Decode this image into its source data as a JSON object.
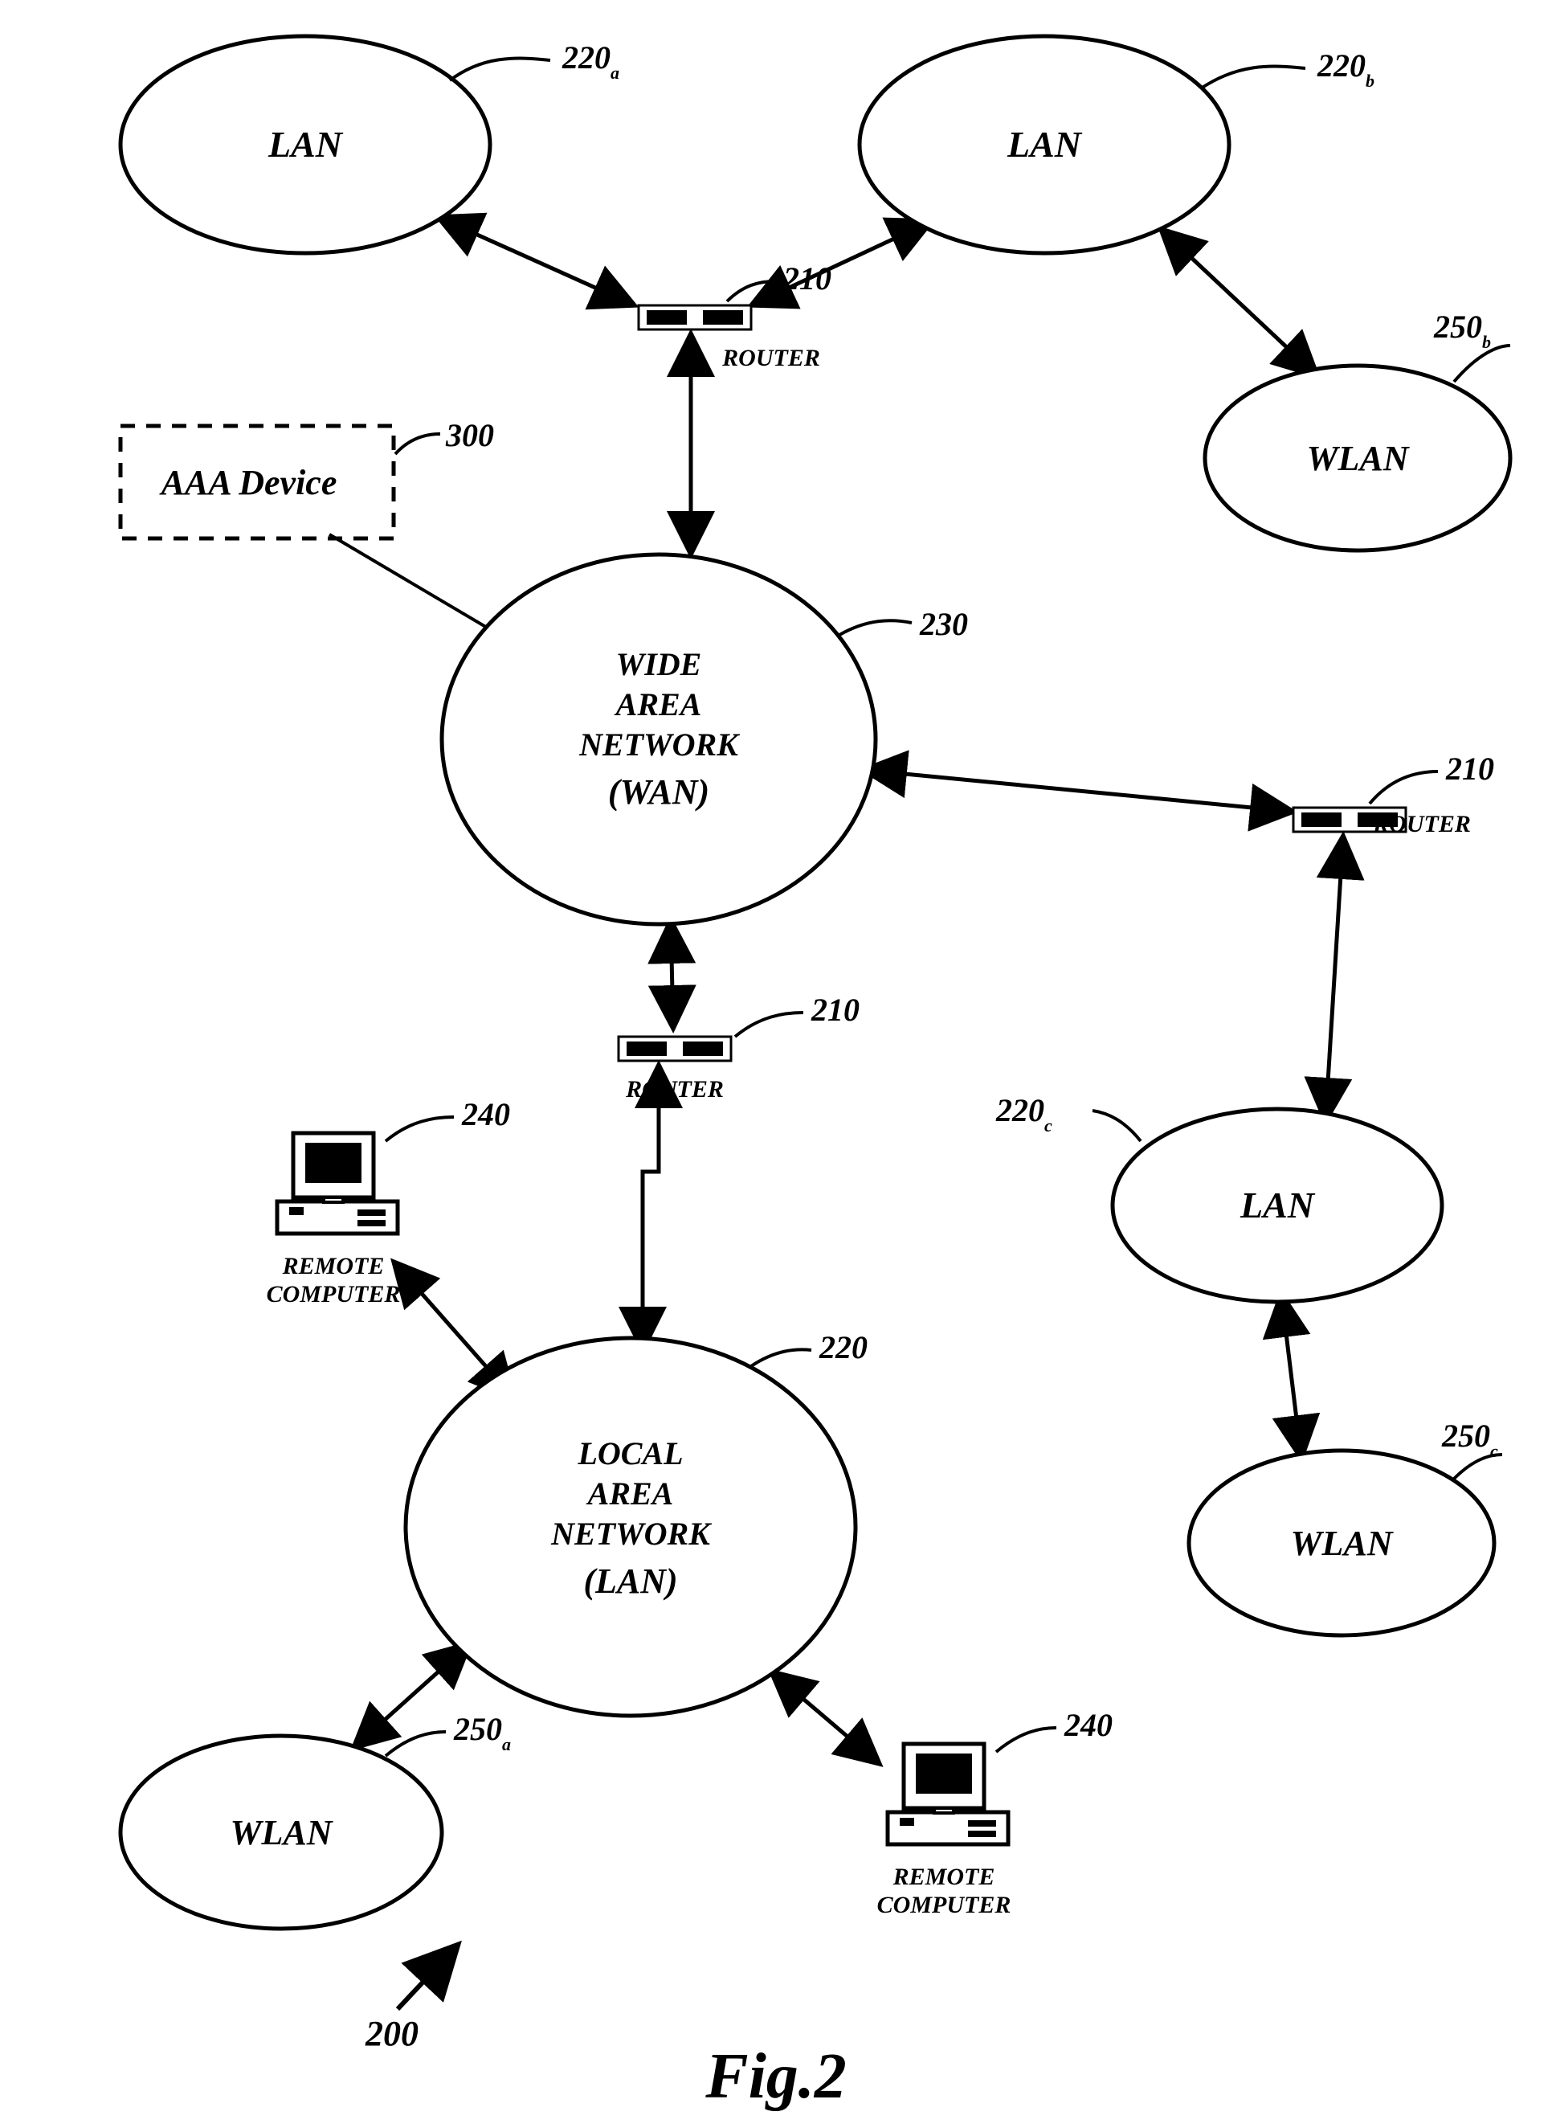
{
  "figure": {
    "caption": "Fig.2",
    "diagram_ref": "200",
    "aaa": {
      "label": "AAA Device",
      "ref": "300"
    },
    "wan": {
      "line1": "WIDE",
      "line2": "AREA",
      "line3": "NETWORK",
      "line4": "(WAN)",
      "ref": "230"
    },
    "lan_main": {
      "line1": "LOCAL",
      "line2": "AREA",
      "line3": "NETWORK",
      "line4": "(LAN)",
      "ref": "220"
    },
    "lan_a": {
      "label": "LAN",
      "ref": "220",
      "sub": "a"
    },
    "lan_b": {
      "label": "LAN",
      "ref": "220",
      "sub": "b"
    },
    "lan_c": {
      "label": "LAN",
      "ref": "220",
      "sub": "c"
    },
    "wlan_a": {
      "label": "WLAN",
      "ref": "250",
      "sub": "a"
    },
    "wlan_b": {
      "label": "WLAN",
      "ref": "250",
      "sub": "b"
    },
    "wlan_c": {
      "label": "WLAN",
      "ref": "250",
      "sub": "c"
    },
    "router": {
      "label": "ROUTER",
      "ref": "210"
    },
    "remote": {
      "line1": "REMOTE",
      "line2": "COMPUTER",
      "ref": "240"
    }
  }
}
